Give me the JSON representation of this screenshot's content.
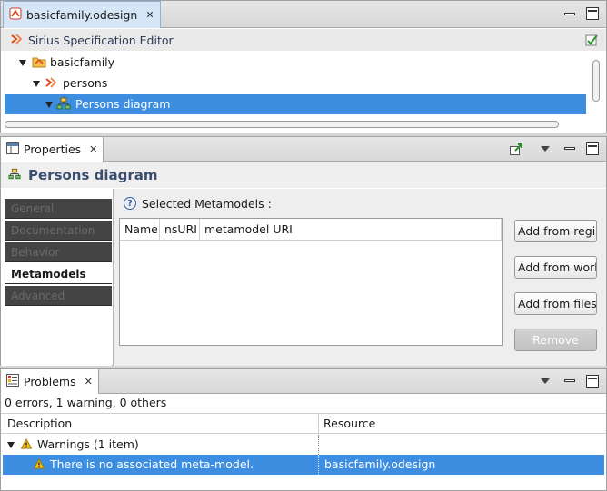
{
  "editor": {
    "tab_label": "basicfamily.odesign",
    "header_title": "Sirius Specification Editor",
    "tree": [
      {
        "label": "basicfamily",
        "level": 0,
        "expanded": true,
        "selected": false
      },
      {
        "label": "persons",
        "level": 1,
        "expanded": true,
        "selected": false
      },
      {
        "label": "Persons diagram",
        "level": 2,
        "expanded": true,
        "selected": true
      }
    ]
  },
  "properties": {
    "tab_label": "Properties",
    "title": "Persons diagram",
    "side_tabs": [
      "General",
      "Documentation",
      "Behavior",
      "Metamodels",
      "Advanced"
    ],
    "active_tab": "Metamodels",
    "section_label": "Selected Metamodels :",
    "table_columns": [
      "Name",
      "nsURI",
      "metamodel URI"
    ],
    "buttons": {
      "add_registry": "Add from registry",
      "add_workspace": "Add from workspace",
      "add_files": "Add from filesystem",
      "remove": "Remove"
    }
  },
  "problems": {
    "tab_label": "Problems",
    "summary": "0 errors, 1 warning, 0 others",
    "columns": [
      "Description",
      "Resource"
    ],
    "group": "Warnings (1 item)",
    "items": [
      {
        "description": "There is no associated meta-model.",
        "resource": "basicfamily.odesign"
      }
    ]
  },
  "colors": {
    "selection": "#3d8ee0",
    "title_text": "#3a4d6e",
    "sidetab_dark": "#444444"
  }
}
